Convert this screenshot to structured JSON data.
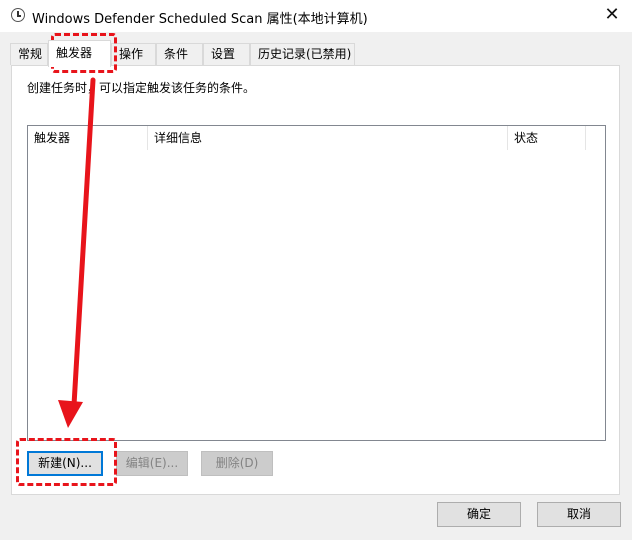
{
  "window": {
    "title": "Windows Defender Scheduled Scan 属性(本地计算机)",
    "close_glyph": "✕"
  },
  "tabs": [
    {
      "label": "常规"
    },
    {
      "label": "触发器"
    },
    {
      "label": "操作"
    },
    {
      "label": "条件"
    },
    {
      "label": "设置"
    },
    {
      "label": "历史记录(已禁用)"
    }
  ],
  "triggers_page": {
    "description": "创建任务时，可以指定触发该任务的条件。",
    "columns": [
      {
        "label": "触发器"
      },
      {
        "label": "详细信息"
      },
      {
        "label": "状态"
      }
    ],
    "rows": [],
    "buttons": {
      "new": "新建(N)...",
      "edit": "编辑(E)...",
      "delete": "删除(D)"
    }
  },
  "footer": {
    "ok": "确定",
    "cancel": "取消"
  },
  "annotation_color": "#e8141b"
}
